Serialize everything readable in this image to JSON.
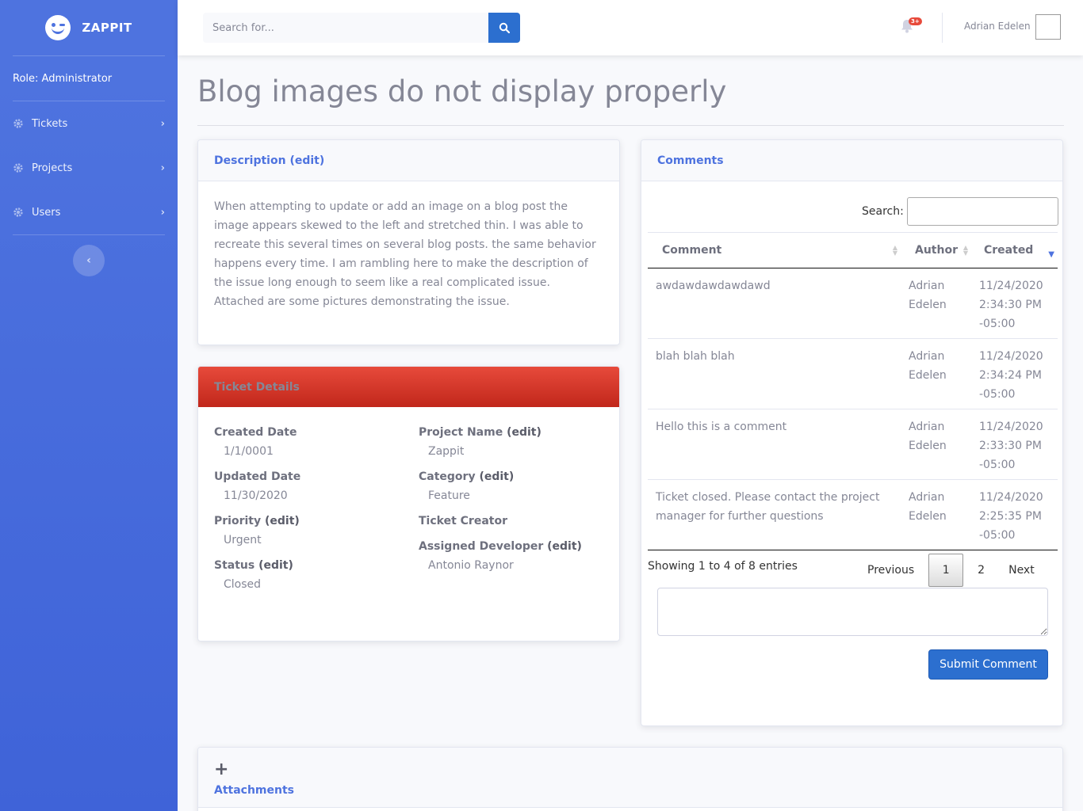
{
  "brand": {
    "name": "ZAPPIT"
  },
  "sidebar": {
    "role": "Role: Administrator",
    "items": [
      {
        "label": "Tickets",
        "icon": "gear-icon"
      },
      {
        "label": "Projects",
        "icon": "gear-icon"
      },
      {
        "label": "Users",
        "icon": "gear-icon"
      }
    ],
    "toggle_glyph": "‹"
  },
  "topbar": {
    "search_placeholder": "Search for...",
    "notification_count": "3+",
    "user_name": "Adrian Edelen"
  },
  "page": {
    "title": "Blog images do not display properly"
  },
  "description": {
    "heading": "Description",
    "edit": "(edit)",
    "text": "When attempting to update or add an image on a blog post the image appears skewed to the left and stretched thin. I was able to recreate this several times on several blog posts. the same behavior happens every time. I am rambling here to make the description of the issue long enough to seem like a real complicated issue. Attached are some pictures demonstrating the issue."
  },
  "details": {
    "heading": "Ticket Details",
    "created_label": "Created Date",
    "created_value": "1/1/0001",
    "updated_label": "Updated Date",
    "updated_value": "11/30/2020",
    "priority_label": "Priority",
    "priority_value": "Urgent",
    "status_label": "Status",
    "status_value": "Closed",
    "project_label": "Project Name",
    "project_value": "Zappit",
    "category_label": "Category",
    "category_value": "Feature",
    "creator_label": "Ticket Creator",
    "creator_value": "",
    "developer_label": "Assigned Developer",
    "developer_value": "Antonio Raynor",
    "edit": "(edit)"
  },
  "comments": {
    "heading": "Comments",
    "search_label": "Search:",
    "columns": [
      "Comment",
      "Author",
      "Created"
    ],
    "rows": [
      {
        "comment": "awdawdawdawdawd",
        "author": "Adrian Edelen",
        "created": "11/24/2020 2:34:30 PM -05:00"
      },
      {
        "comment": "blah blah blah",
        "author": "Adrian Edelen",
        "created": "11/24/2020 2:34:24 PM -05:00"
      },
      {
        "comment": "Hello this is a comment",
        "author": "Adrian Edelen",
        "created": "11/24/2020 2:33:30 PM -05:00"
      },
      {
        "comment": "Ticket closed. Please contact the project manager for further questions",
        "author": "Adrian Edelen",
        "created": "11/24/2020 2:25:35 PM -05:00"
      }
    ],
    "info": "Showing 1 to 4 of 8 entries",
    "previous": "Previous",
    "pages": [
      "1",
      "2"
    ],
    "next": "Next",
    "submit": "Submit Comment"
  },
  "attachments": {
    "plus": "+",
    "heading": "Attachments"
  },
  "colors": {
    "primary": "#4e73df",
    "button": "#2c6fcf",
    "danger": "#e74a3b"
  }
}
